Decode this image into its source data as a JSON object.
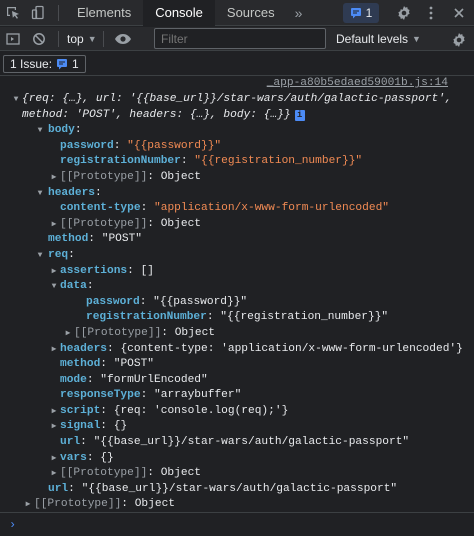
{
  "tabbar": {
    "tabs": [
      {
        "label": "Elements"
      },
      {
        "label": "Console"
      },
      {
        "label": "Sources"
      }
    ],
    "more": "»",
    "issues_count": "1"
  },
  "toolbar": {
    "context": "top",
    "filter_placeholder": "Filter",
    "levels": "Default levels"
  },
  "issues_bar": {
    "label": "1 Issue:",
    "count": "1"
  },
  "console": {
    "source_link": "_app-a80b5edaed59001b.js:14",
    "summary_line1": "{req: {…}, url: '{{base_url}}/star-wars/auth/galactic-passport',",
    "summary_line2": "method: 'POST', headers: {…}, body: {…}}",
    "body_key": "body",
    "password_key": "password",
    "password_val": "\"{{password}}\"",
    "regnum_key": "registrationNumber",
    "regnum_val": "\"{{registration_number}}\"",
    "proto": "[[Prototype]]",
    "object": "Object",
    "headers_key": "headers",
    "content_type_key": "content-type",
    "content_type_val": "\"application/x-www-form-urlencoded\"",
    "method_key": "method",
    "method_val": "\"POST\"",
    "req_key": "req",
    "assertions_key": "assertions",
    "assertions_val": "[]",
    "data_key": "data",
    "req_headers_summary": "{content-type: 'application/x-www-form-urlencoded'}",
    "mode_key": "mode",
    "mode_val": "\"formUrlEncoded\"",
    "response_type_key": "responseType",
    "response_type_val": "\"arraybuffer\"",
    "script_key": "script",
    "script_val": "{req: 'console.log(req);'}",
    "signal_key": "signal",
    "signal_val": "{}",
    "url_key": "url",
    "url_val": "\"{{base_url}}/star-wars/auth/galactic-passport\"",
    "vars_key": "vars",
    "vars_val": "{}"
  },
  "colors": {
    "background": "#202124",
    "toolbar": "#292a2d",
    "key": "#5db0d7",
    "string": "#f28b54",
    "accent": "#4c8bf5"
  }
}
